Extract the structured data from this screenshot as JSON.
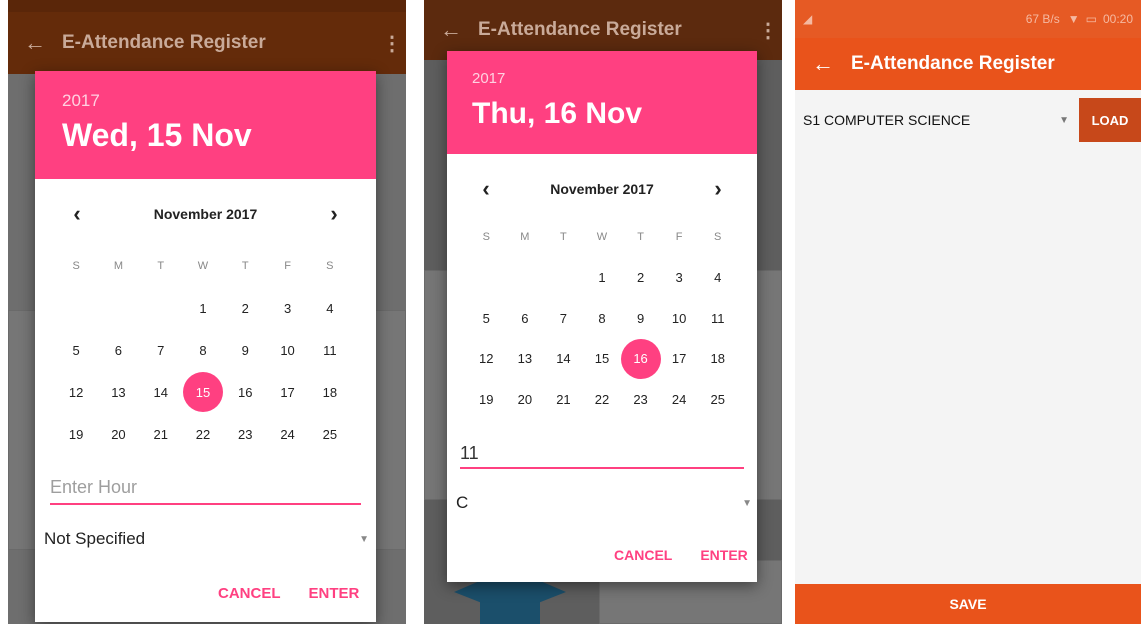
{
  "app": {
    "title": "E-Attendance Register"
  },
  "left": {
    "dialog": {
      "year": "2017",
      "date": "Wed, 15 Nov",
      "month": "November 2017",
      "weekdays": [
        "S",
        "M",
        "T",
        "W",
        "T",
        "F",
        "S"
      ],
      "days": [
        "",
        "",
        "",
        "1",
        "2",
        "3",
        "4",
        "5",
        "6",
        "7",
        "8",
        "9",
        "10",
        "11",
        "12",
        "13",
        "14",
        "15",
        "16",
        "17",
        "18",
        "19",
        "20",
        "21",
        "22",
        "23",
        "24",
        "25"
      ],
      "selected": "15",
      "hour_placeholder": "Enter Hour",
      "spinner_value": "Not Specified",
      "cancel": "CANCEL",
      "enter": "ENTER"
    }
  },
  "middle": {
    "dialog": {
      "year": "2017",
      "date": "Thu, 16 Nov",
      "month": "November 2017",
      "weekdays": [
        "S",
        "M",
        "T",
        "W",
        "T",
        "F",
        "S"
      ],
      "days": [
        "",
        "",
        "",
        "1",
        "2",
        "3",
        "4",
        "5",
        "6",
        "7",
        "8",
        "9",
        "10",
        "11",
        "12",
        "13",
        "14",
        "15",
        "16",
        "17",
        "18",
        "19",
        "20",
        "21",
        "22",
        "23",
        "24",
        "25"
      ],
      "selected": "16",
      "hour_value": "11",
      "spinner_value": "C",
      "cancel": "CANCEL",
      "enter": "ENTER"
    }
  },
  "right": {
    "status": {
      "speed": "67 B/s",
      "time": "00:20"
    },
    "class_value": "S1 COMPUTER SCIENCE",
    "load": "LOAD",
    "save": "SAVE"
  },
  "colors": {
    "accent": "#ff4081",
    "primary": "#e9531b",
    "primary_dark": "#c7481a"
  },
  "icons": [
    "back-arrow-icon",
    "overflow-menu-icon",
    "chevron-left-icon",
    "chevron-right-icon",
    "dropdown-caret-icon",
    "graduation-cap-icon",
    "signal-icon",
    "wifi-icon",
    "battery-icon"
  ]
}
